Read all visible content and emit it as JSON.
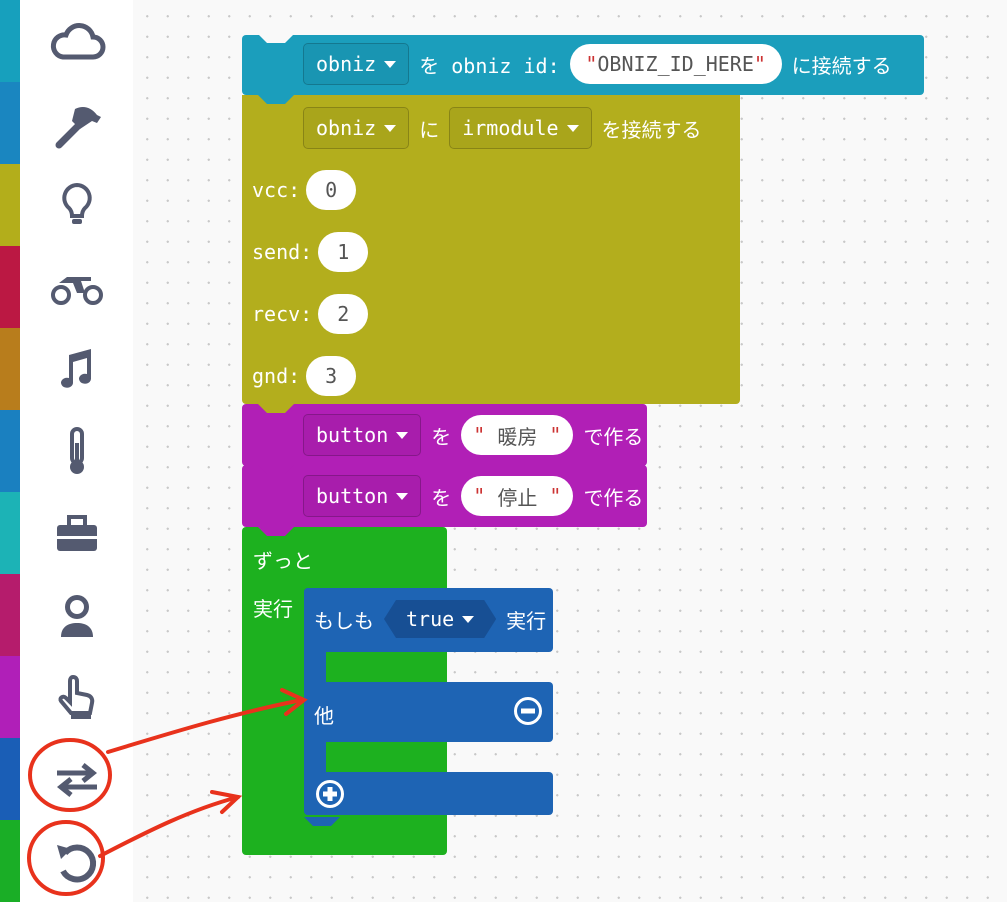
{
  "toolbox": {
    "categories": [
      {
        "icon": "cloud-icon",
        "color": "#17a0bd"
      },
      {
        "icon": "hammer-icon",
        "color": "#1a86c0"
      },
      {
        "icon": "lightbulb-icon",
        "color": "#b3ae1b"
      },
      {
        "icon": "motorcycle-icon",
        "color": "#bb1843"
      },
      {
        "icon": "music-note-icon",
        "color": "#b87d1c"
      },
      {
        "icon": "thermometer-icon",
        "color": "#1a80c0"
      },
      {
        "icon": "toolbox-icon",
        "color": "#1cb3b6"
      },
      {
        "icon": "astronaut-icon",
        "color": "#b51c6c"
      },
      {
        "icon": "pointing-hand-icon",
        "color": "#b01fb8"
      },
      {
        "icon": "exchange-arrows-icon",
        "color": "#1a5eb6"
      },
      {
        "icon": "undo-loop-icon",
        "color": "#1aae26"
      }
    ]
  },
  "blocks": {
    "connect": {
      "color": "#1b9ebc",
      "var": "obniz",
      "text1": "を obniz id:",
      "id_value": "OBNIZ_ID_HERE",
      "quote": "\"",
      "text2": "に接続する"
    },
    "irmodule": {
      "color": "#b3ae1d",
      "var": "obniz",
      "text1": "に",
      "module": "irmodule",
      "text2": "を接続する",
      "pins": [
        {
          "label": "vcc:",
          "value": "0"
        },
        {
          "label": "send:",
          "value": "1"
        },
        {
          "label": "recv:",
          "value": "2"
        },
        {
          "label": "gnd:",
          "value": "3"
        }
      ]
    },
    "buttons": [
      {
        "color": "#b11fb6",
        "var": "button",
        "text1": "を",
        "value": "暖房",
        "text2": "で作る"
      },
      {
        "color": "#b11fb6",
        "var": "button",
        "text1": "を",
        "value": "停止",
        "text2": "で作る"
      }
    ],
    "forever": {
      "color": "#1db11f",
      "label": "ずっと",
      "do_label": "実行"
    },
    "if": {
      "color": "#1e64b4",
      "label": "もしも",
      "condition": "true",
      "then_label": "実行",
      "else_label": "他"
    }
  },
  "annotation_color": "#e8321c"
}
